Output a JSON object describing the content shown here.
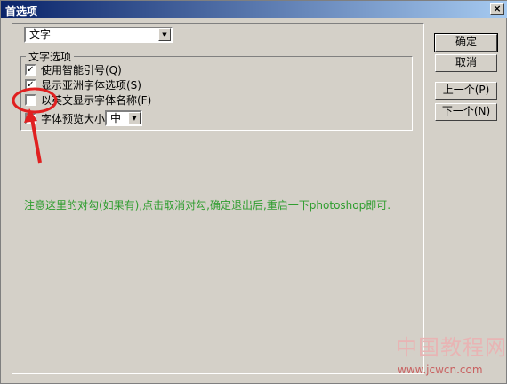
{
  "window": {
    "title": "首选项",
    "close_glyph": "×"
  },
  "section_select": {
    "value": "文字"
  },
  "group": {
    "label": "文字选项",
    "options": [
      {
        "label": "使用智能引号(Q)",
        "checked": true
      },
      {
        "label": "显示亚洲字体选项(S)",
        "checked": true
      },
      {
        "label": "以英文显示字体名称(F)",
        "checked": false
      },
      {
        "label": "字体预览大小:",
        "checked": true
      }
    ],
    "preview_size": {
      "value": "中"
    }
  },
  "buttons": {
    "ok": "确定",
    "cancel": "取消",
    "prev": "上一个(P)",
    "next": "下一个(N)"
  },
  "note": "注意这里的对勾(如果有),点击取消对勾,确定退出后,重启一下photoshop即可.",
  "watermark": {
    "big": "中国教程网",
    "small": "www.jcwcn.com"
  },
  "colors": {
    "titlebar_start": "#0a246a",
    "note": "#2e9d2e",
    "annotation": "#e02020"
  },
  "check_glyph": "✓"
}
